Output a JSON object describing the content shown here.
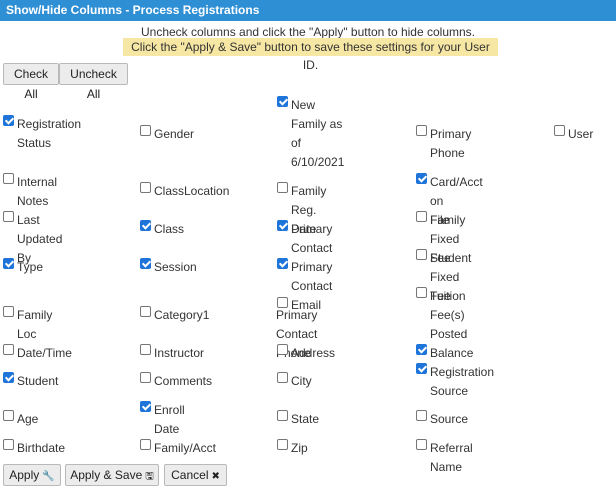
{
  "window": {
    "title": "Show/Hide Columns - Process Registrations"
  },
  "instructions": {
    "line1": "Uncheck columns and click the \"Apply\" button to hide columns.",
    "line2": "Click the \"Apply & Save\" button to save these settings for your User ID."
  },
  "toolbar": {
    "check_all": "Check All",
    "uncheck_all": "Uncheck All"
  },
  "columns": [
    {
      "label": "Registration\nStatus",
      "checked": true
    },
    {
      "label": "Gender",
      "checked": false
    },
    {
      "label": "New\nFamily as\nof\n6/10/2021",
      "checked": true
    },
    {
      "label": "Primary Phone",
      "checked": false
    },
    {
      "label": "User",
      "checked": false
    },
    {
      "label": "Internal\nNotes",
      "checked": false
    },
    {
      "label": "ClassLocation",
      "checked": false
    },
    {
      "label": "Family Reg. Date",
      "checked": false
    },
    {
      "label": "Card/Acct on\nFile",
      "checked": true
    },
    {
      "label": "Last Updated\nBy",
      "checked": false
    },
    {
      "label": "Class",
      "checked": true
    },
    {
      "label": "Primary Contact",
      "checked": true
    },
    {
      "label": "Family\nFixed Fee",
      "checked": false
    },
    {
      "label": "Type",
      "checked": true
    },
    {
      "label": "Session",
      "checked": true
    },
    {
      "label": "Primary Contact Email",
      "checked": true
    },
    {
      "label": "Student\nFixed Fee",
      "checked": false
    },
    {
      "label": "Family Loc",
      "checked": false
    },
    {
      "label": "Category1",
      "checked": false
    },
    {
      "label": "Primary Contact Phone",
      "checked": false
    },
    {
      "label": "Tuition\nFee(s)\nPosted",
      "checked": false
    },
    {
      "label": "Date/Time",
      "checked": false
    },
    {
      "label": "Instructor",
      "checked": false
    },
    {
      "label": "Address",
      "checked": false
    },
    {
      "label": "Balance",
      "checked": true
    },
    {
      "label": "Student",
      "checked": true
    },
    {
      "label": "Comments",
      "checked": false
    },
    {
      "label": "City",
      "checked": false
    },
    {
      "label": "Registration\nSource",
      "checked": true
    },
    {
      "label": "Age",
      "checked": false
    },
    {
      "label": "Enroll\nDate",
      "checked": true
    },
    {
      "label": "State",
      "checked": false
    },
    {
      "label": "Source",
      "checked": false
    },
    {
      "label": "Birthdate",
      "checked": false
    },
    {
      "label": "Family/Acct",
      "checked": false
    },
    {
      "label": "Zip",
      "checked": false
    },
    {
      "label": "Referral Name",
      "checked": false
    }
  ],
  "footer": {
    "apply": "Apply",
    "apply_save": "Apply & Save",
    "cancel": "Cancel"
  },
  "icons": {
    "apply": "wrench-icon",
    "apply_save": "save-icon",
    "cancel": "close-icon"
  },
  "colors": {
    "titlebar": "#2f8fd4",
    "highlight": "#f7e7a4",
    "checkbox_checked": "#1e74d9"
  }
}
